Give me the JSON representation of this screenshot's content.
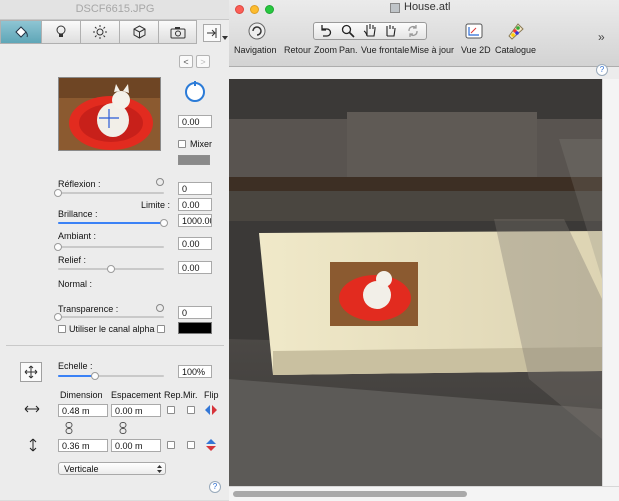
{
  "panel": {
    "title": "DSCF6615.JPG",
    "tabs": [
      {
        "icon": "paint-bucket-icon",
        "selected": true
      },
      {
        "icon": "lightbulb-icon",
        "selected": false
      },
      {
        "icon": "sun-icon",
        "selected": false
      },
      {
        "icon": "cube-icon",
        "selected": false
      },
      {
        "icon": "camera-icon",
        "selected": false
      }
    ],
    "nav": {
      "prev": "<",
      "next": ">"
    },
    "rotation_value": "0.00",
    "mixer_label": "Mixer",
    "reflection": {
      "label": "Réflexion :",
      "value": "0",
      "level": 0
    },
    "limit": {
      "label": "Limite :",
      "value": "0.00"
    },
    "shininess": {
      "label": "Brillance :",
      "value": "1000.00",
      "level": 1.0
    },
    "ambient": {
      "label": "Ambiant :",
      "value": "0.00",
      "level": 0
    },
    "relief": {
      "label": "Relief :",
      "value": "0.00",
      "level": 0.5
    },
    "normal_label": "Normal :",
    "transparency": {
      "label": "Transparence :",
      "value": "0",
      "level": 0
    },
    "alpha_label": "Utiliser le canal alpha",
    "scale": {
      "label": "Echelle :",
      "value": "100%",
      "level": 0.35
    },
    "headers": {
      "dimension": "Dimension",
      "spacing": "Espacement",
      "rep": "Rep.",
      "mir": "Mir.",
      "flip": "Flip"
    },
    "row_h": {
      "dimension": "0.48 m",
      "spacing": "0.00 m"
    },
    "row_v": {
      "dimension": "0.36 m",
      "spacing": "0.00 m"
    },
    "orientation": "Verticale",
    "help": "?"
  },
  "window": {
    "title": "House.atl",
    "toolbar": [
      {
        "label": "Navigation",
        "icon": "navigation-icon"
      },
      {
        "label": "Retour",
        "icon": "undo-icon"
      },
      {
        "label": "Zoom",
        "icon": "zoom-icon"
      },
      {
        "label": "Pan.",
        "icon": "pan-hand-icon"
      },
      {
        "label": "Vue frontale",
        "icon": "front-view-icon"
      },
      {
        "label": "Mise à jour",
        "icon": "refresh-icon"
      },
      {
        "label": "Vue 2D",
        "icon": "view-2d-icon"
      },
      {
        "label": "Catalogue",
        "icon": "catalogue-icon"
      }
    ],
    "overflow": "»",
    "help": "?"
  }
}
